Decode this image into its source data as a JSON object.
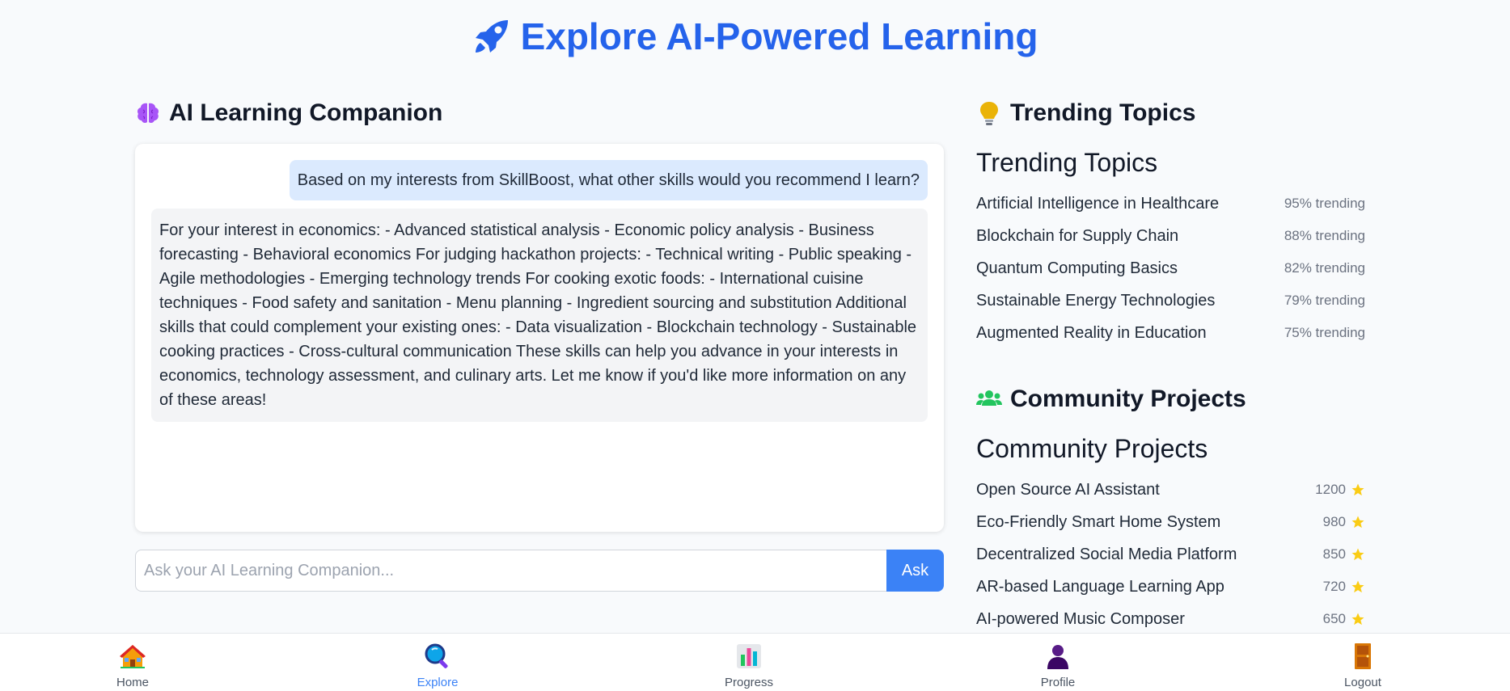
{
  "title": "Explore AI-Powered Learning",
  "companion": {
    "heading": "AI Learning Companion",
    "user_message": "Based on my interests from SkillBoost, what other skills would you recommend I learn?",
    "ai_message": "For your interest in economics: - Advanced statistical analysis - Economic policy analysis - Business forecasting - Behavioral economics For judging hackathon projects: - Technical writing - Public speaking - Agile methodologies - Emerging technology trends For cooking exotic foods: - International cuisine techniques - Food safety and sanitation - Menu planning - Ingredient sourcing and substitution Additional skills that could complement your existing ones: - Data visualization - Blockchain technology - Sustainable cooking practices - Cross-cultural communication These skills can help you advance in your interests in economics, technology assessment, and culinary arts. Let me know if you'd like more information on any of these areas!",
    "input_placeholder": "Ask your AI Learning Companion...",
    "ask_label": "Ask"
  },
  "trending": {
    "heading": "Trending Topics",
    "subheading": "Trending Topics",
    "items": [
      {
        "name": "Artificial Intelligence in Healthcare",
        "meta": "95% trending"
      },
      {
        "name": "Blockchain for Supply Chain",
        "meta": "88% trending"
      },
      {
        "name": "Quantum Computing Basics",
        "meta": "82% trending"
      },
      {
        "name": "Sustainable Energy Technologies",
        "meta": "79% trending"
      },
      {
        "name": "Augmented Reality in Education",
        "meta": "75% trending"
      }
    ]
  },
  "community": {
    "heading": "Community Projects",
    "subheading": "Community Projects",
    "items": [
      {
        "name": "Open Source AI Assistant",
        "stars": "1200"
      },
      {
        "name": "Eco-Friendly Smart Home System",
        "stars": "980"
      },
      {
        "name": "Decentralized Social Media Platform",
        "stars": "850"
      },
      {
        "name": "AR-based Language Learning App",
        "stars": "720"
      },
      {
        "name": "AI-powered Music Composer",
        "stars": "650"
      }
    ]
  },
  "nav": {
    "items": [
      {
        "label": "Home",
        "icon": "house-icon"
      },
      {
        "label": "Explore",
        "icon": "magnifier-icon",
        "active": true
      },
      {
        "label": "Progress",
        "icon": "bar-chart-icon"
      },
      {
        "label": "Profile",
        "icon": "person-icon"
      },
      {
        "label": "Logout",
        "icon": "door-icon"
      }
    ]
  },
  "colors": {
    "accent": "#2563eb",
    "button": "#3b82f6",
    "user_bubble": "#dbeafe",
    "ai_bubble": "#f3f4f6",
    "star": "#facc15"
  }
}
